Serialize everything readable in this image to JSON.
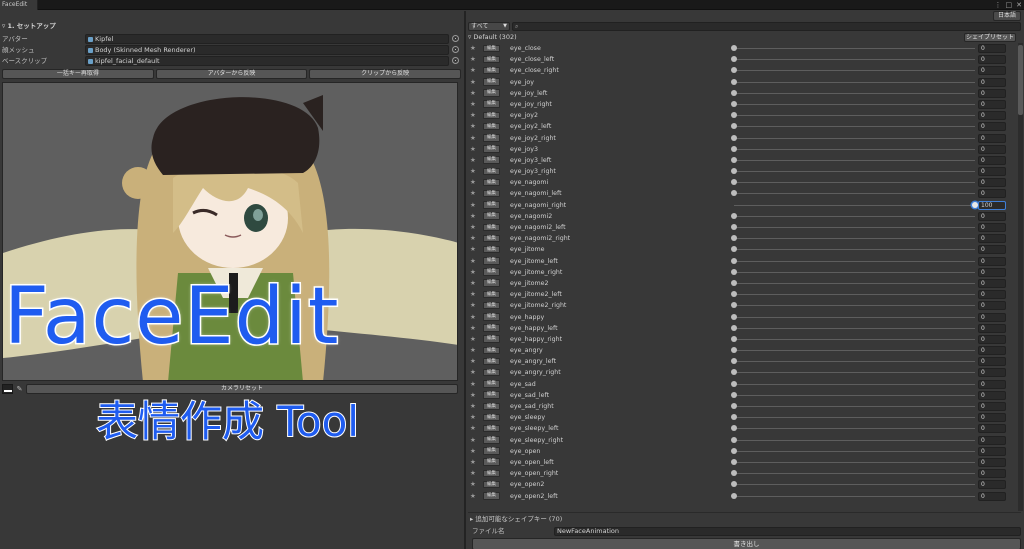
{
  "window": {
    "tab_label": "FaceEdit",
    "menu_icon": "kebab-menu-icon",
    "maximize_icon": "maximize-icon",
    "close_icon": "close-icon"
  },
  "setup": {
    "section_title": "▿ 1. セットアップ",
    "fields": [
      {
        "label": "アバター",
        "value": "Kipfel"
      },
      {
        "label": "顔メッシュ",
        "value": "Body (Skinned Mesh Renderer)"
      },
      {
        "label": "ベースクリップ",
        "value": "kipfel_facial_default"
      }
    ],
    "buttons": [
      "一括キー再取得",
      "アバターから反映",
      "クリップから反映"
    ],
    "camera_reset": "カメラリセット"
  },
  "overlay": {
    "title": "FaceEdit",
    "subtitle": "表情作成 Tool"
  },
  "right": {
    "language_button": "日本語",
    "filter_selected": "すべて",
    "search_placeholder": "",
    "group_header": "▿ Default (302)",
    "shape_reset": "シェイプリセット",
    "edit_label": "編集",
    "shapes": [
      {
        "name": "eye_close",
        "value": "0"
      },
      {
        "name": "eye_close_left",
        "value": "0"
      },
      {
        "name": "eye_close_right",
        "value": "0"
      },
      {
        "name": "eye_joy",
        "value": "0"
      },
      {
        "name": "eye_joy_left",
        "value": "0"
      },
      {
        "name": "eye_joy_right",
        "value": "0"
      },
      {
        "name": "eye_joy2",
        "value": "0"
      },
      {
        "name": "eye_joy2_left",
        "value": "0"
      },
      {
        "name": "eye_joy2_right",
        "value": "0"
      },
      {
        "name": "eye_joy3",
        "value": "0"
      },
      {
        "name": "eye_joy3_left",
        "value": "0"
      },
      {
        "name": "eye_joy3_right",
        "value": "0"
      },
      {
        "name": "eye_nagomi",
        "value": "0"
      },
      {
        "name": "eye_nagomi_left",
        "value": "0"
      },
      {
        "name": "eye_nagomi_right",
        "value": "100"
      },
      {
        "name": "eye_nagomi2",
        "value": "0"
      },
      {
        "name": "eye_nagomi2_left",
        "value": "0"
      },
      {
        "name": "eye_nagomi2_right",
        "value": "0"
      },
      {
        "name": "eye_jitome",
        "value": "0"
      },
      {
        "name": "eye_jitome_left",
        "value": "0"
      },
      {
        "name": "eye_jitome_right",
        "value": "0"
      },
      {
        "name": "eye_jitome2",
        "value": "0"
      },
      {
        "name": "eye_jitome2_left",
        "value": "0"
      },
      {
        "name": "eye_jitome2_right",
        "value": "0"
      },
      {
        "name": "eye_happy",
        "value": "0"
      },
      {
        "name": "eye_happy_left",
        "value": "0"
      },
      {
        "name": "eye_happy_right",
        "value": "0"
      },
      {
        "name": "eye_angry",
        "value": "0"
      },
      {
        "name": "eye_angry_left",
        "value": "0"
      },
      {
        "name": "eye_angry_right",
        "value": "0"
      },
      {
        "name": "eye_sad",
        "value": "0"
      },
      {
        "name": "eye_sad_left",
        "value": "0"
      },
      {
        "name": "eye_sad_right",
        "value": "0"
      },
      {
        "name": "eye_sleepy",
        "value": "0"
      },
      {
        "name": "eye_sleepy_left",
        "value": "0"
      },
      {
        "name": "eye_sleepy_right",
        "value": "0"
      },
      {
        "name": "eye_open",
        "value": "0"
      },
      {
        "name": "eye_open_left",
        "value": "0"
      },
      {
        "name": "eye_open_right",
        "value": "0"
      },
      {
        "name": "eye_open2",
        "value": "0"
      },
      {
        "name": "eye_open2_left",
        "value": "0"
      }
    ],
    "addable_keys": "▸ 追加可能なシェイプキー (70)",
    "file_label": "ファイル名",
    "file_name": "NewFaceAnimation",
    "export_button": "書き出し"
  },
  "colors": {
    "panel_bg": "#383838",
    "overlay_text": "#1f5cf0",
    "active_accent": "#3f7fd8"
  }
}
